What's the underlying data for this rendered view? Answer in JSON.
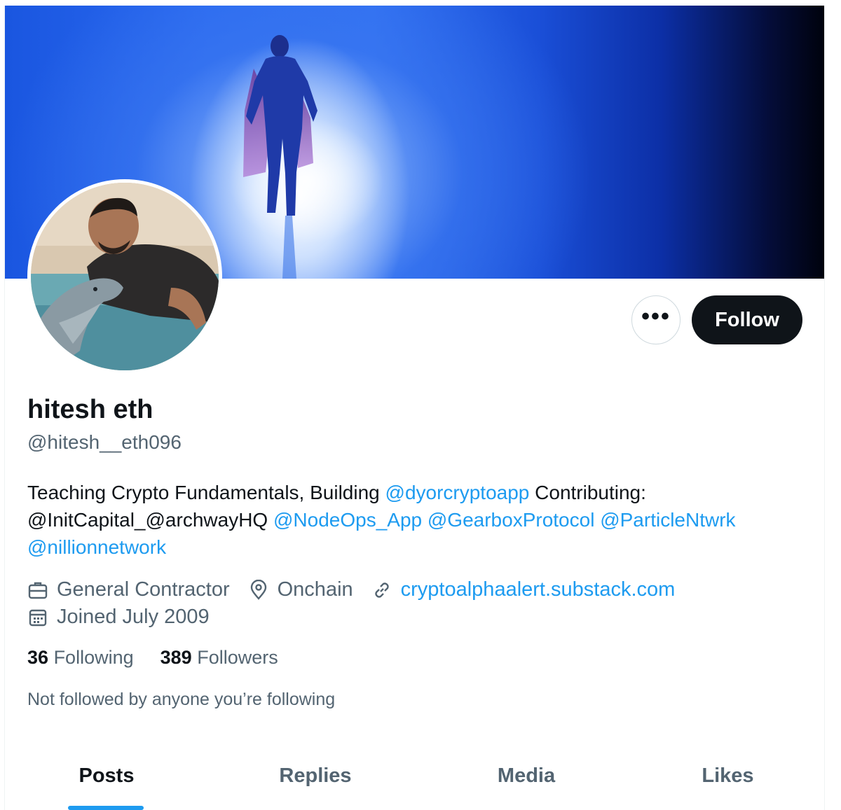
{
  "profile": {
    "name": "hitesh eth",
    "handle": "@hitesh__eth096",
    "bio": {
      "text1": "Teaching Crypto Fundamentals, Building ",
      "mention1": "@dyorcryptoapp",
      "text2": " Contributing: @InitCapital_@archwayHQ ",
      "mention2": "@NodeOps_App",
      "mention3": "@GearboxProtocol",
      "mention4": "@ParticleNtwrk",
      "mention5": "@nillionnetwork"
    },
    "profession": "General Contractor",
    "location": "Onchain",
    "website": "cryptoalphaalert.substack.com",
    "joined": "Joined July 2009"
  },
  "actions": {
    "more_label": "•••",
    "follow_label": "Follow"
  },
  "stats": {
    "following_count": "36",
    "following_label": "Following",
    "followers_count": "389",
    "followers_label": "Followers"
  },
  "social_context": "Not followed by anyone you’re following",
  "tabs": [
    {
      "label": "Posts",
      "active": true
    },
    {
      "label": "Replies",
      "active": false
    },
    {
      "label": "Media",
      "active": false
    },
    {
      "label": "Likes",
      "active": false
    }
  ],
  "icons": {
    "profession": "briefcase-icon",
    "location": "location-pin-icon",
    "website": "link-icon",
    "joined": "calendar-icon",
    "more": "more-icon"
  },
  "colors": {
    "accent": "#1d9bf0",
    "text_primary": "#0f1419",
    "text_secondary": "#536471",
    "follow_bg": "#0f1419"
  }
}
